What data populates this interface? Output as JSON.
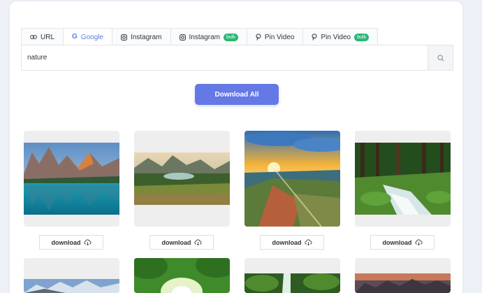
{
  "tabs": [
    {
      "label": "URL",
      "icon": "link-icon",
      "active": false
    },
    {
      "label": "Google",
      "icon": "google-icon",
      "active": true
    },
    {
      "label": "Instagram",
      "icon": "instagram-icon",
      "active": false
    },
    {
      "label": "Instagram",
      "icon": "instagram-icon",
      "badge": "bulk",
      "active": false
    },
    {
      "label": "Pin Video",
      "icon": "pinterest-icon",
      "active": false
    },
    {
      "label": "Pin Video",
      "icon": "pinterest-icon",
      "badge": "bulk",
      "active": false
    }
  ],
  "search": {
    "value": "nature",
    "button_icon": "search-icon"
  },
  "actions": {
    "download_all_label": "Download All"
  },
  "images": [
    {
      "download_label": "download"
    },
    {
      "download_label": "download"
    },
    {
      "download_label": "download"
    },
    {
      "download_label": "download"
    }
  ],
  "colors": {
    "accent": "#6478e6",
    "active_tab": "#5b7fd6",
    "badge": "#2bb673",
    "background": "#eef0f7"
  }
}
